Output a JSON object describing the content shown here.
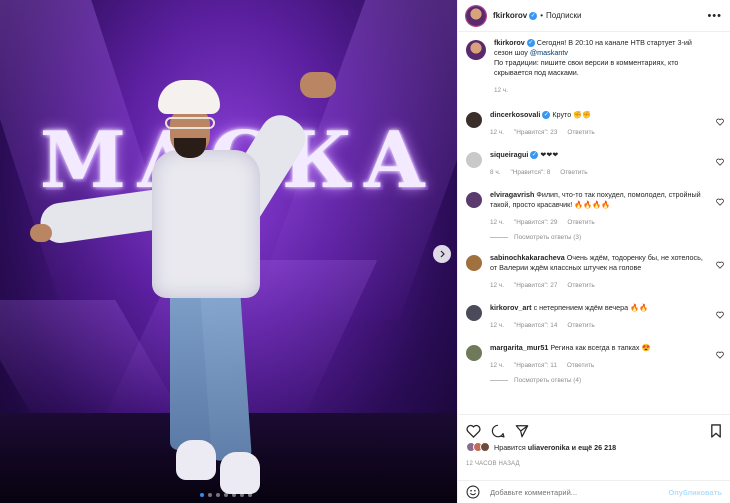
{
  "photo": {
    "logo_text": "МАСКА",
    "carousel_index": 1,
    "carousel_count": 7
  },
  "header": {
    "username": "fkirkorov",
    "separator": "•",
    "follow_label": "Подписки",
    "more_icon": "ellipsis-icon"
  },
  "caption": {
    "username": "fkirkorov",
    "text_before": "Сегодня! В 20:10 на канале НТВ стартует 3-ий сезон шоу ",
    "mention": "@maskantv",
    "text_after": "По традиции: пишите свои версии в комментариях, кто скрывается под масками.",
    "time": "12 ч."
  },
  "comments": [
    {
      "username": "dincerkosovali",
      "verified": true,
      "text": "Круто ✊✊",
      "time": "12 ч.",
      "likes": "\"Нравится\": 23",
      "reply": "Ответить",
      "avatar_color": "#3a2f2b"
    },
    {
      "username": "siqueiragui",
      "verified": true,
      "text": "❤❤❤",
      "time": "8 ч.",
      "likes": "\"Нравится\": 8",
      "reply": "Ответить",
      "avatar_color": "#c9c9c9"
    },
    {
      "username": "elviragavrish",
      "verified": false,
      "text": "Филип, что-то так похудел, помолодел, стройный такой, просто красавчик! 🔥🔥🔥🔥",
      "time": "12 ч.",
      "likes": "\"Нравится\": 29",
      "reply": "Ответить",
      "avatar_color": "#5b3a6e",
      "replies": "Посмотреть ответы (3)"
    },
    {
      "username": "sabinochkakaracheva",
      "verified": false,
      "text": "Очень ждём, тодоренку бы, не хотелось, от Валерии ждём классных штучек на голове",
      "time": "12 ч.",
      "likes": "\"Нравится\": 27",
      "reply": "Ответить",
      "avatar_color": "#a0703f"
    },
    {
      "username": "kirkorov_art",
      "verified": false,
      "text": "с нетерпением ждём вечера 🔥🔥",
      "time": "12 ч.",
      "likes": "\"Нравится\": 14",
      "reply": "Ответить",
      "avatar_color": "#4a4a5a"
    },
    {
      "username": "margarita_mur51",
      "verified": false,
      "text": "Регина как всегда в тапках 😍",
      "time": "12 ч.",
      "likes": "\"Нравится\": 11",
      "reply": "Ответить",
      "avatar_color": "#6f7a5a",
      "replies": "Посмотреть ответы (4)"
    }
  ],
  "likes": {
    "prefix": "Нравится",
    "user": "uliaveronika",
    "suffix": "и ещё 26 218"
  },
  "timestamp": "12 ЧАСОВ НАЗАД",
  "add_comment": {
    "placeholder": "Добавьте комментарий...",
    "post_label": "Опубликовать"
  },
  "colors": {
    "accent": "#0095f6",
    "verified": "#3897f0",
    "muted": "#8e8e8e"
  }
}
